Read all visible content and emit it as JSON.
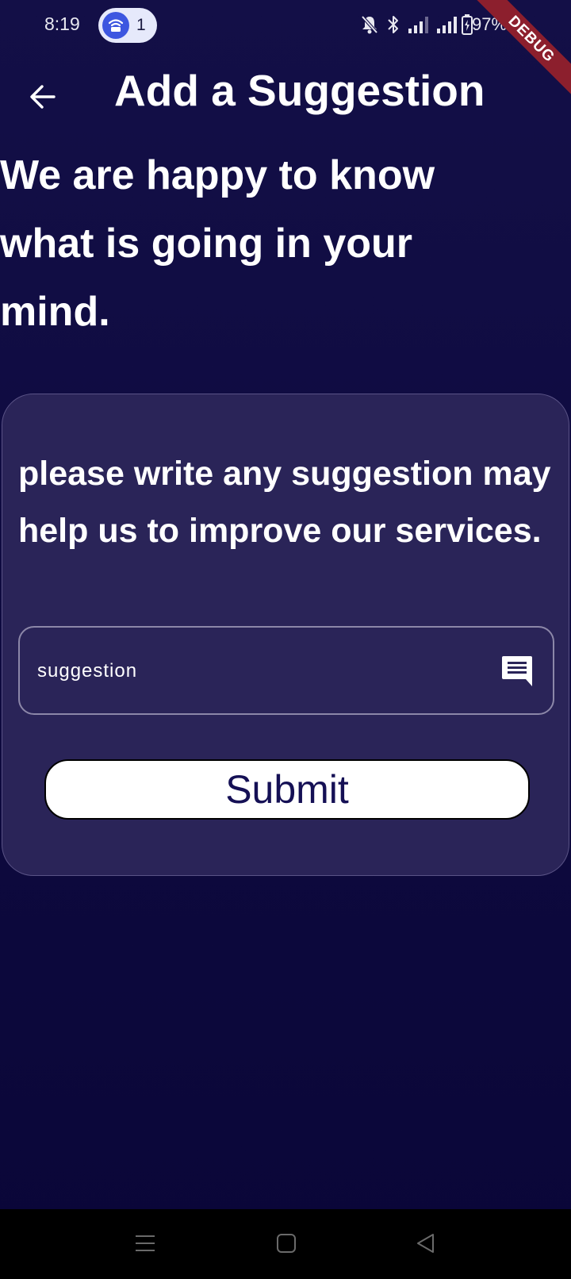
{
  "status_bar": {
    "time": "8:19",
    "hotspot_count": "1",
    "battery_text": "97%",
    "icons": [
      "hotspot-icon",
      "mute-icon",
      "bluetooth-icon",
      "signal-icon",
      "signal-icon",
      "battery-icon"
    ]
  },
  "debug_banner": "DEBUG",
  "app_bar": {
    "back_icon": "arrow-back-icon",
    "title": "Add a Suggestion"
  },
  "headline": "We are happy to know what is going in your mind.",
  "card": {
    "prompt": "please write any suggestion may help us to improve our services.",
    "suggestion_field": {
      "placeholder": "suggestion",
      "value": "",
      "icon": "message-icon"
    },
    "submit_label": "Submit"
  },
  "nav_bar": {
    "icons": [
      "menu-icon",
      "home-icon",
      "back-icon"
    ]
  },
  "colors": {
    "background": "#130f47",
    "card": "#2a2458",
    "button_text": "#151055",
    "debug": "#8c1f2d"
  }
}
